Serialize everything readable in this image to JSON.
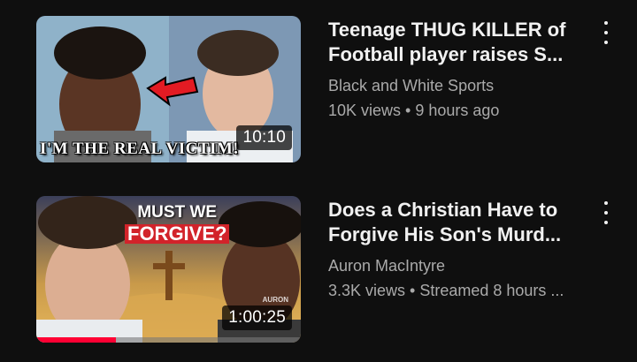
{
  "videos": [
    {
      "title": "Teenage THUG KILLER of Football player raises S...",
      "channel": "Black and White Sports",
      "stats": "10K views • 9 hours ago",
      "duration": "10:10",
      "thumbnail_caption": "I'M THE REAL VICTIM!"
    },
    {
      "title": "Does a Christian Have to Forgive His Son's Murd...",
      "channel": "Auron MacIntyre",
      "stats": "3.3K views • Streamed 8 hours ...",
      "duration": "1:00:25",
      "thumbnail_headline_1": "MUST WE",
      "thumbnail_headline_2": "FORGIVE?",
      "thumbnail_watermark": "AURON",
      "watch_progress": 0.3
    }
  ],
  "colors": {
    "background": "#0f0f0f",
    "title": "#f1f1f1",
    "secondary": "#aaaaaa",
    "progress": "#ff0033"
  },
  "icons": {
    "more": "vertical-ellipsis-icon"
  }
}
